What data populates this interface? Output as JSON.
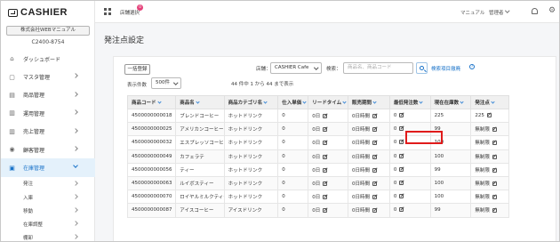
{
  "app": {
    "logo_text": "CASHIER"
  },
  "sidebar": {
    "company": "株式会社WEBマニュアル",
    "code": "C2400-8754",
    "items": [
      {
        "label": "ダッシュボード",
        "icon": "home-icon",
        "chevron": false
      },
      {
        "label": "マスタ管理",
        "icon": "box-icon",
        "chevron": true
      },
      {
        "label": "商品管理",
        "icon": "store-icon",
        "chevron": true
      },
      {
        "label": "運用管理",
        "icon": "clipboard-icon",
        "chevron": true
      },
      {
        "label": "売上管理",
        "icon": "bar-chart-icon",
        "chevron": true
      },
      {
        "label": "顧客管理",
        "icon": "user-icon",
        "chevron": true
      },
      {
        "label": "在庫管理",
        "icon": "inventory-icon",
        "chevron": true,
        "active": true
      }
    ],
    "sub_items": [
      {
        "label": "発注",
        "chevron": true
      },
      {
        "label": "入庫",
        "chevron": true
      },
      {
        "label": "移動",
        "chevron": true
      },
      {
        "label": "在庫調整",
        "chevron": true
      },
      {
        "label": "棚卸",
        "chevron": true
      }
    ]
  },
  "topbar": {
    "store_select": "店舗選択",
    "badge_count": "0",
    "manual_link": "マニュアル",
    "user_name": "管理者"
  },
  "page": {
    "title": "発注点設定",
    "bulk_button": "一括登録",
    "store_label": "店舗：",
    "store_value": "CASHIER Cafe",
    "search_label": "検索：",
    "search_placeholder": "商品名、商品コード",
    "search_settings_link": "検索項目撤廃",
    "per_page_label": "表示件数",
    "per_page_value": "500件",
    "count_text": "44 件中 1 から 44 まで表示"
  },
  "table": {
    "headers": [
      "商品コード",
      "商品名",
      "商品カテゴリ名",
      "仕入単価",
      "リードタイム",
      "販売期間",
      "最低発注数",
      "現在在庫数",
      "発注点"
    ],
    "rows": [
      [
        "4500000000018",
        "ブレンドコーヒー",
        "ホットドリンク",
        "0",
        "0日",
        "0日時間",
        "0",
        "225",
        "225"
      ],
      [
        "4500000000025",
        "アメリカンコーヒー",
        "ホットドリンク",
        "0",
        "0日",
        "0日時間",
        "0",
        "99",
        "無制限"
      ],
      [
        "4500000000032",
        "エスプレッソコーヒー",
        "ホットドリンク",
        "0",
        "0日",
        "0日時間",
        "0",
        "100",
        "無制限"
      ],
      [
        "4500000000049",
        "カフェラテ",
        "ホットドリンク",
        "0",
        "0日",
        "0日時間",
        "0",
        "100",
        "無制限"
      ],
      [
        "4500000000056",
        "ティー",
        "ホットドリンク",
        "0",
        "0日",
        "0日時間",
        "0",
        "99",
        "無制限"
      ],
      [
        "4500000000063",
        "ルイボスティー",
        "ホットドリンク",
        "0",
        "0日",
        "0日時間",
        "0",
        "100",
        "無制限"
      ],
      [
        "4500000000070",
        "ロイヤルミルクティー",
        "ホットドリンク",
        "0",
        "0日",
        "0日時間",
        "0",
        "100",
        "無制限"
      ],
      [
        "4500000000087",
        "アイスコーヒー",
        "アイスドリンク",
        "0",
        "0日",
        "0日時間",
        "0",
        "99",
        "無制限"
      ]
    ]
  },
  "colors": {
    "accent": "#1a73c9",
    "highlight": "#e01b1b",
    "badge": "#e5427a"
  }
}
